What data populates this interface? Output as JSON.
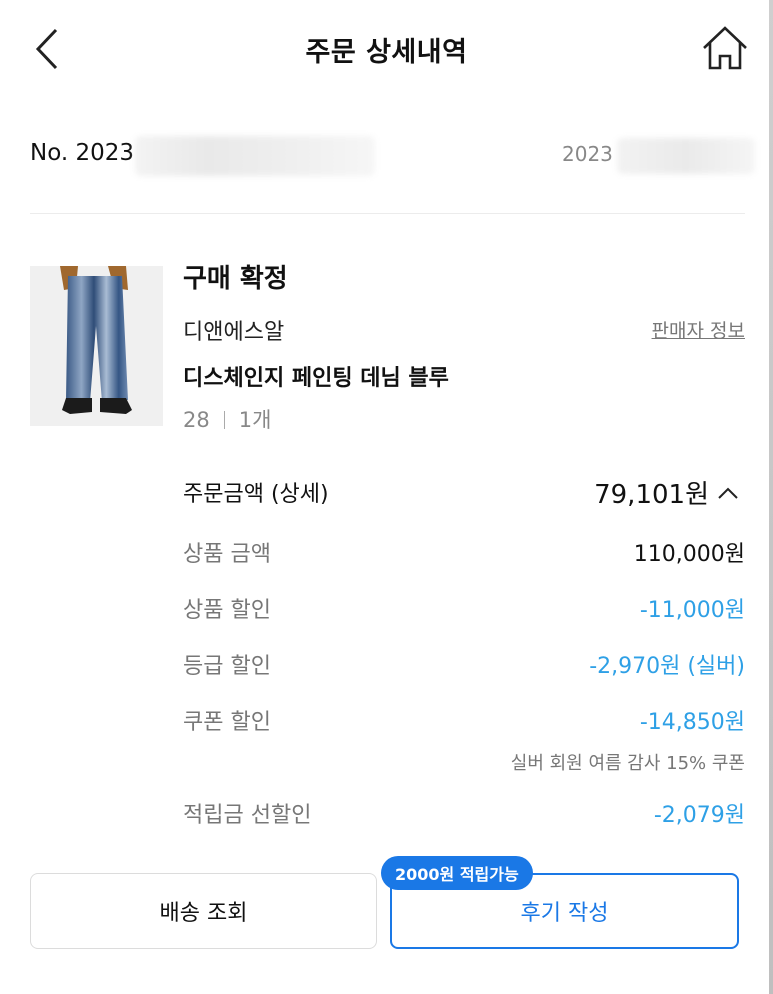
{
  "header": {
    "title": "주문 상세내역"
  },
  "order": {
    "number": "No. 2023",
    "date": "2023"
  },
  "item": {
    "status": "구매 확정",
    "brand": "디앤에스알",
    "seller_link": "판매자 정보",
    "product_name": "디스체인지 페인팅 데님 블루",
    "size": "28",
    "quantity": "1개"
  },
  "price": {
    "total_label": "주문금액 (상세)",
    "total_value": "79,101원",
    "rows": [
      {
        "label": "상품 금액",
        "value": "110,000원"
      },
      {
        "label": "상품 할인",
        "value": "-11,000원"
      },
      {
        "label": "등급 할인",
        "value": "-2,970원 (실버)"
      },
      {
        "label": "쿠폰 할인",
        "value": "-14,850원"
      },
      {
        "label": "적립금 선할인",
        "value": "-2,079원"
      }
    ],
    "coupon_note": "실버 회원 여름 감사 15% 쿠폰"
  },
  "actions": {
    "track_label": "배송 조회",
    "review_label": "후기 작성",
    "reward_badge": "2000원 적립가능"
  },
  "colors": {
    "accent": "#1a78e6",
    "discount": "#2ea0e6"
  }
}
